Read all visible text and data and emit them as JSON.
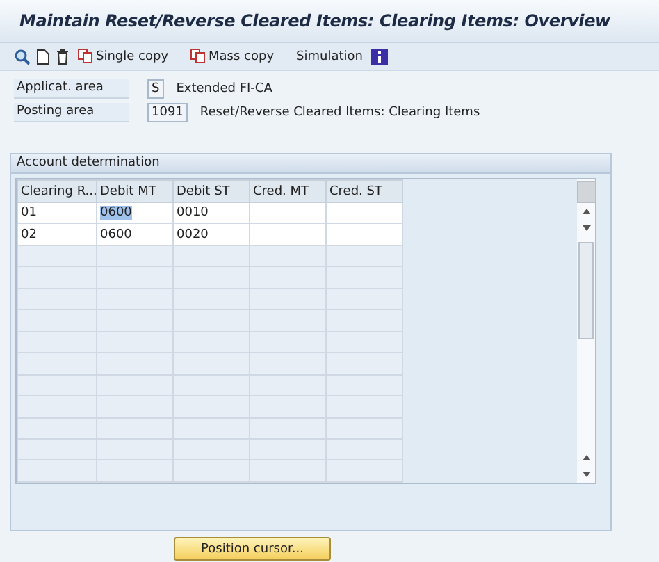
{
  "window": {
    "title": "Maintain Reset/Reverse Cleared Items: Clearing Items: Overview"
  },
  "toolbar": [
    {
      "kind": "display"
    },
    {
      "kind": "new"
    },
    {
      "kind": "delete"
    },
    {
      "kind": "copy",
      "label": "Single copy"
    },
    {
      "kind": "copy",
      "label": "Mass copy"
    },
    {
      "kind": "text",
      "label": "Simulation"
    },
    {
      "kind": "info"
    }
  ],
  "fields": [
    {
      "label": "Applicat. area",
      "value": "S",
      "description": "Extended FI-CA"
    },
    {
      "label": "Posting area",
      "value": "1091",
      "description": "Reset/Reverse Cleared Items: Clearing Items"
    }
  ],
  "group": {
    "title": "Account determination",
    "table": {
      "columns": [
        "Clearing R...",
        "Debit MT",
        "Debit ST",
        "Cred. MT",
        "Cred. ST"
      ],
      "rows": [
        {
          "cells": [
            {
              "text": "01",
              "highlighted": false
            },
            {
              "text": "0600",
              "highlighted": true
            },
            {
              "text": "0010",
              "highlighted": false
            }
          ]
        },
        {
          "cells": [
            {
              "text": "02",
              "highlighted": false
            },
            {
              "text": "0600",
              "highlighted": false
            },
            {
              "text": "0020",
              "highlighted": false
            }
          ]
        }
      ]
    }
  },
  "buttons": [
    {
      "label": "Position cursor..."
    }
  ]
}
